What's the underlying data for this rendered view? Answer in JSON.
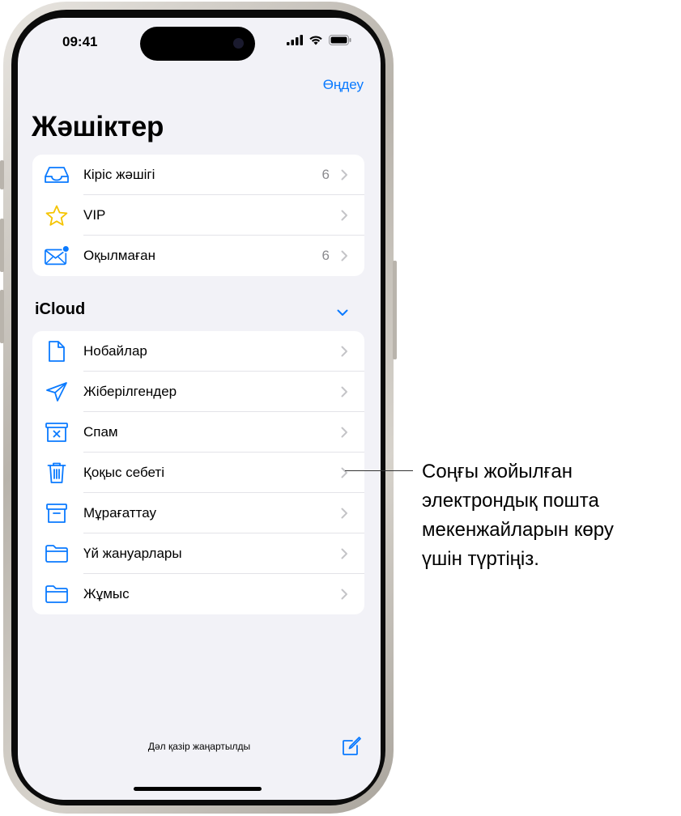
{
  "status_bar": {
    "time": "09:41"
  },
  "nav": {
    "edit_label": "Өңдеу"
  },
  "page_title": "Жәшіктер",
  "top_group": [
    {
      "label": "Кіріс жәшігі",
      "count": "6",
      "icon": "inbox-tray-icon"
    },
    {
      "label": "VIP",
      "count": "",
      "icon": "star-icon"
    },
    {
      "label": "Оқылмаған",
      "count": "6",
      "icon": "envelope-unread-icon"
    }
  ],
  "icloud": {
    "title": "iCloud",
    "items": [
      {
        "label": "Нобайлар",
        "icon": "draft-document-icon"
      },
      {
        "label": "Жіберілгендер",
        "icon": "paper-plane-icon"
      },
      {
        "label": "Спам",
        "icon": "junk-box-icon"
      },
      {
        "label": "Қоқыс себеті",
        "icon": "trash-icon"
      },
      {
        "label": "Мұрағаттау",
        "icon": "archive-box-icon"
      },
      {
        "label": "Үй жануарлары",
        "icon": "folder-icon"
      },
      {
        "label": "Жұмыс",
        "icon": "folder-icon"
      }
    ]
  },
  "footer": {
    "status_text": "Дәл қазір жаңартылды"
  },
  "callout": {
    "lines": [
      "Соңғы жойылған",
      "электрондық пошта",
      "мекенжайларын көру",
      "үшін түртіңіз."
    ]
  },
  "colors": {
    "accent": "#0a7aff",
    "star": "#f5c400",
    "background": "#f2f2f7"
  }
}
